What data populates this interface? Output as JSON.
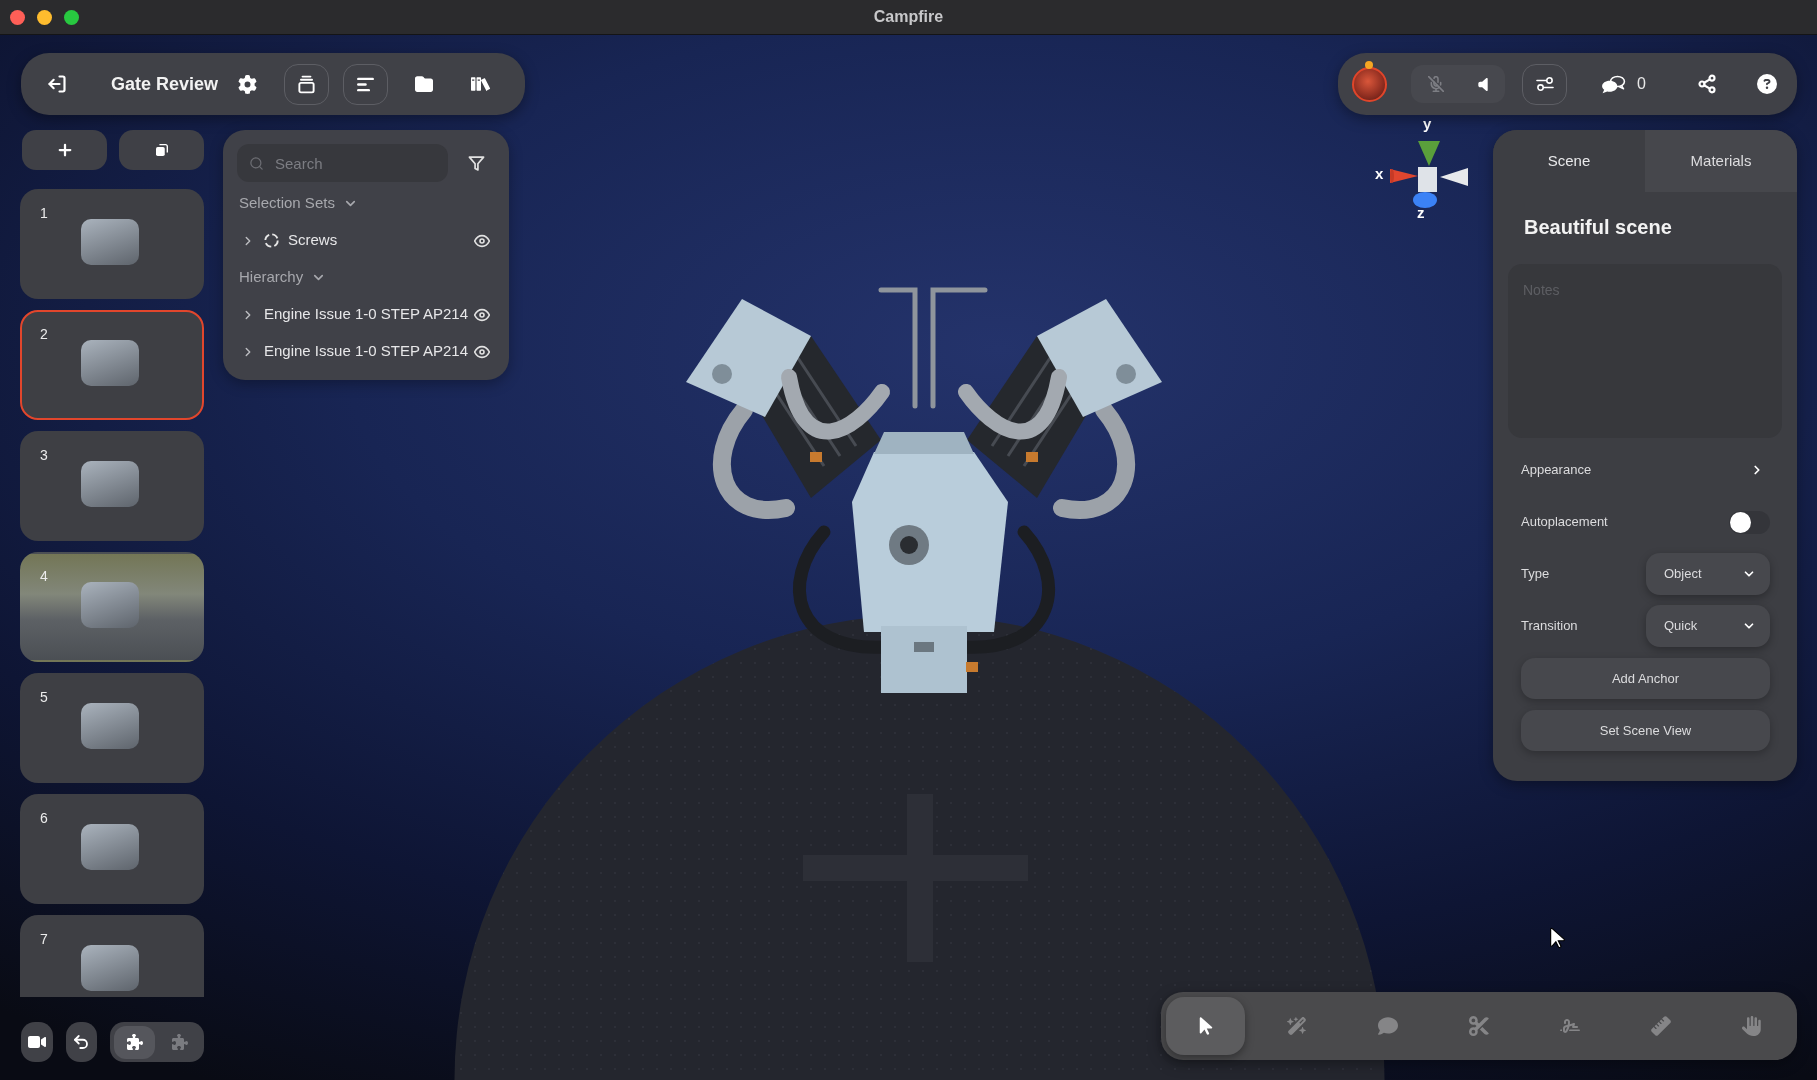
{
  "window": {
    "title": "Campfire"
  },
  "project_toolbar": {
    "title": "Gate Review"
  },
  "scenes": [
    {
      "number": "1",
      "kind": "model",
      "selected": false
    },
    {
      "number": "2",
      "kind": "model",
      "selected": true
    },
    {
      "number": "3",
      "kind": "model",
      "selected": false
    },
    {
      "number": "4",
      "kind": "photo",
      "selected": false
    },
    {
      "number": "5",
      "kind": "model",
      "selected": false
    },
    {
      "number": "6",
      "kind": "model",
      "selected": false
    },
    {
      "number": "7",
      "kind": "model",
      "selected": false
    }
  ],
  "view_modes": [
    {
      "selected": true
    },
    {
      "selected": false
    }
  ],
  "outline": {
    "search": {
      "placeholder": "Search"
    },
    "sections": [
      {
        "title": "Selection Sets",
        "expanded": true,
        "items": [
          {
            "label": "Screws",
            "kind": "set",
            "expanded": false,
            "visible": true
          }
        ]
      },
      {
        "title": "Hierarchy",
        "expanded": true,
        "items": [
          {
            "label": "Engine Issue 1-0 STEP AP214",
            "kind": "part",
            "expanded": false,
            "visible": true
          },
          {
            "label": "Engine Issue 1-0 STEP AP214",
            "kind": "part",
            "expanded": false,
            "visible": true
          }
        ]
      }
    ]
  },
  "session_toolbar": {
    "microphone": {
      "muted": true
    },
    "comment_count": "0"
  },
  "axis_gizmo": {
    "labels": [
      "y",
      "x",
      "z"
    ]
  },
  "properties_panel": {
    "tabs": [
      {
        "label": "Scene",
        "selected": true
      },
      {
        "label": "Materials",
        "selected": false
      }
    ],
    "title": "Beautiful scene",
    "notes": {
      "placeholder": "Notes"
    },
    "rows": [
      {
        "kind": "link",
        "label": "Appearance"
      },
      {
        "kind": "toggle",
        "label": "Autoplacement",
        "on": false
      },
      {
        "kind": "select",
        "label": "Type",
        "value": "Object"
      },
      {
        "kind": "select",
        "label": "Transition",
        "value": "Quick"
      }
    ],
    "buttons": [
      "Add Anchor",
      "Set Scene View"
    ]
  },
  "tools": [
    {
      "selected": true
    },
    {
      "selected": false
    },
    {
      "selected": false
    },
    {
      "selected": false
    },
    {
      "selected": false
    },
    {
      "selected": false
    },
    {
      "selected": false
    }
  ]
}
